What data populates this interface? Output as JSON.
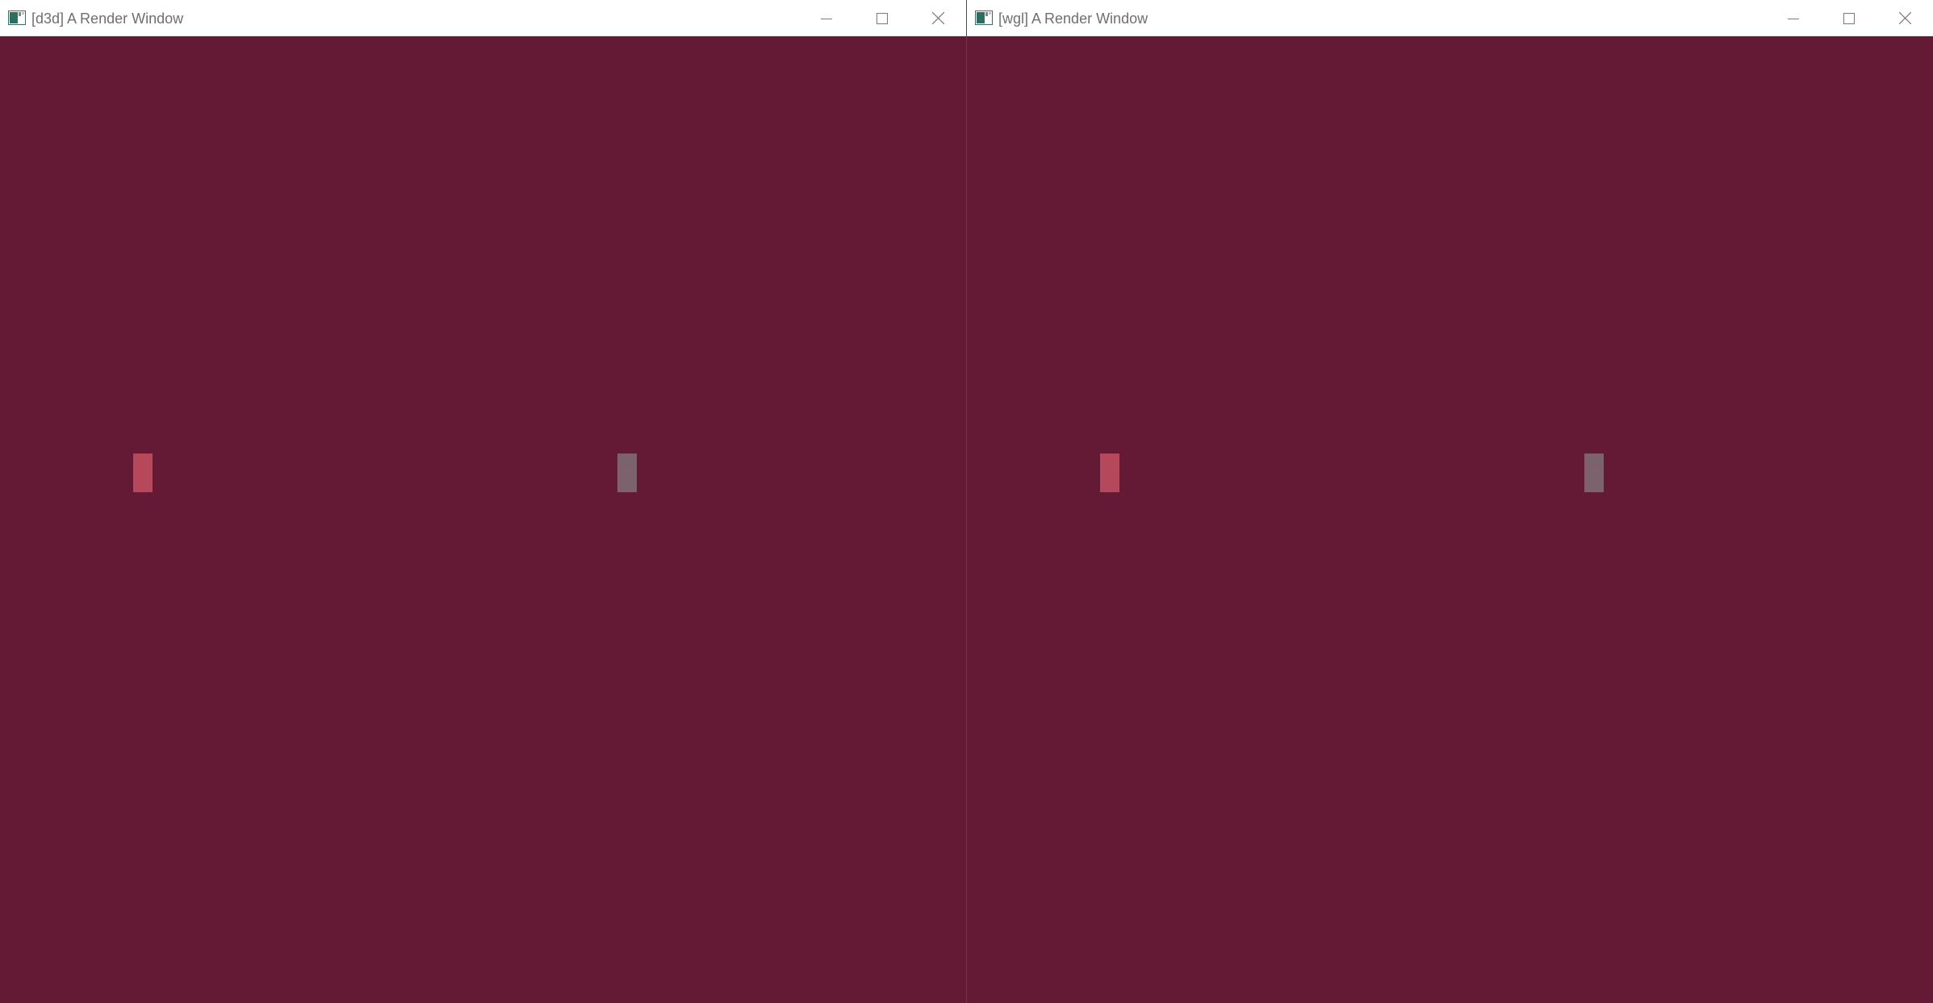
{
  "windows": [
    {
      "title": "[d3d] A Render Window",
      "icon": "app-window-icon",
      "caption_buttons": [
        "minimize-icon",
        "maximize-icon",
        "close-icon"
      ],
      "clear_color": "#641a34",
      "quads": [
        {
          "name": "red-quad",
          "color": "#b5495b"
        },
        {
          "name": "grey-quad",
          "color": "#7b626d"
        }
      ]
    },
    {
      "title": "[wgl] A Render Window",
      "icon": "app-window-icon",
      "caption_buttons": [
        "minimize-icon",
        "maximize-icon",
        "close-icon"
      ],
      "clear_color": "#641a34",
      "quads": [
        {
          "name": "red-quad",
          "color": "#b5495b"
        },
        {
          "name": "grey-quad",
          "color": "#7b626d"
        }
      ]
    }
  ],
  "colors": {
    "titlebar_bg": "#ffffff",
    "title_text": "#6f6f6f",
    "background": "#641a34"
  }
}
